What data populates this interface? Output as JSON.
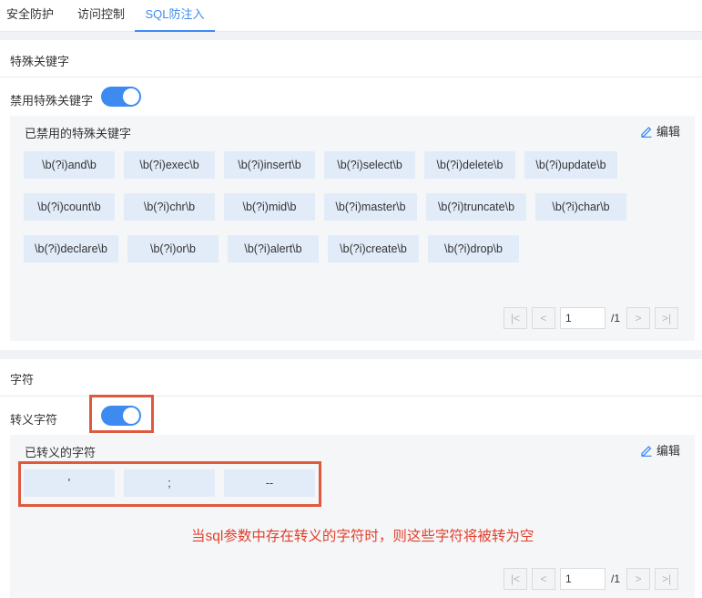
{
  "tabs": [
    {
      "label": "安全防护"
    },
    {
      "label": "访问控制"
    },
    {
      "label": "SQL防注入"
    }
  ],
  "keywords_section": {
    "title": "特殊关键字",
    "toggle_label": "禁用特殊关键字",
    "toggle_on": true,
    "list_title": "已禁用的特殊关键字",
    "edit_label": "编辑",
    "items": [
      "\\b(?i)and\\b",
      "\\b(?i)exec\\b",
      "\\b(?i)insert\\b",
      "\\b(?i)select\\b",
      "\\b(?i)delete\\b",
      "\\b(?i)update\\b",
      "\\b(?i)count\\b",
      "\\b(?i)chr\\b",
      "\\b(?i)mid\\b",
      "\\b(?i)master\\b",
      "\\b(?i)truncate\\b",
      "\\b(?i)char\\b",
      "\\b(?i)declare\\b",
      "\\b(?i)or\\b",
      "\\b(?i)alert\\b",
      "\\b(?i)create\\b",
      "\\b(?i)drop\\b"
    ],
    "pager": {
      "page": "1",
      "total": "/1"
    }
  },
  "chars_section": {
    "title": "字符",
    "toggle_label": "转义字符",
    "toggle_on": true,
    "list_title": "已转义的字符",
    "edit_label": "编辑",
    "items": [
      "'",
      ";",
      "--"
    ],
    "annotation": "当sql参数中存在转义的字符时，则这些字符将被转为空",
    "pager": {
      "page": "1",
      "total": "/1"
    }
  },
  "colors": {
    "accent": "#3d8bf0",
    "chip_bg": "#e2ecf9",
    "annotation_red": "#e0593e"
  }
}
